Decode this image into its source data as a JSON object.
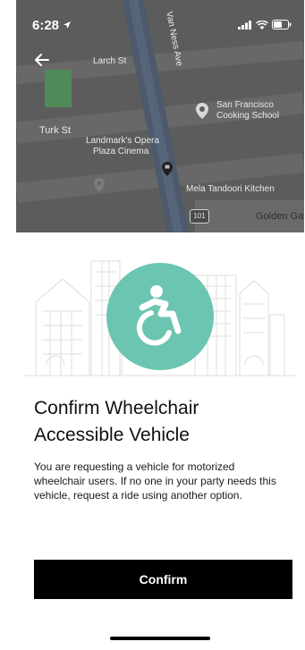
{
  "status_bar": {
    "time": "6:28",
    "location_icon": "location-arrow-icon",
    "signal_icon": "cellular-signal-icon",
    "wifi_icon": "wifi-icon",
    "battery_icon": "battery-icon"
  },
  "map": {
    "streets": {
      "larch": "Larch St",
      "van_ness": "Van Ness Ave",
      "turk": "Turk St",
      "golden_gate": "Golden Gat"
    },
    "pois": {
      "cooking_school": "San Francisco Cooking School",
      "cooking_school_line1": "San Francisco",
      "cooking_school_line2": "Cooking School",
      "cinema_line1": "Landmark's Opera",
      "cinema_line2": "Plaza Cinema",
      "restaurant": "Mela Tandoori Kitchen",
      "highway_shield": "101"
    }
  },
  "navigation": {
    "back_icon": "back-arrow-icon"
  },
  "sheet": {
    "hero_icon": "wheelchair-accessible-icon",
    "accent_color": "#6cc5b0",
    "title_line1": "Confirm Wheelchair",
    "title_line2": "Accessible Vehicle",
    "description": "You are requesting a vehicle for motorized wheelchair users. If no one in your party needs this vehicle, request a ride using another option.",
    "confirm_label": "Confirm"
  }
}
